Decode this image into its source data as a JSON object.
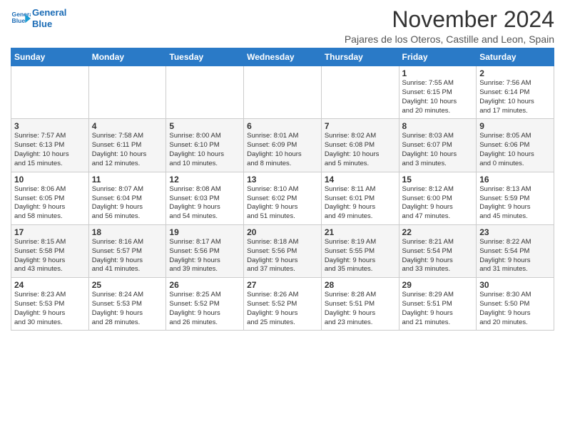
{
  "header": {
    "logo_line1": "General",
    "logo_line2": "Blue",
    "month_title": "November 2024",
    "subtitle": "Pajares de los Oteros, Castille and Leon, Spain"
  },
  "weekdays": [
    "Sunday",
    "Monday",
    "Tuesday",
    "Wednesday",
    "Thursday",
    "Friday",
    "Saturday"
  ],
  "weeks": [
    {
      "days": [
        {
          "num": "",
          "info": ""
        },
        {
          "num": "",
          "info": ""
        },
        {
          "num": "",
          "info": ""
        },
        {
          "num": "",
          "info": ""
        },
        {
          "num": "",
          "info": ""
        },
        {
          "num": "1",
          "info": "Sunrise: 7:55 AM\nSunset: 6:15 PM\nDaylight: 10 hours\nand 20 minutes."
        },
        {
          "num": "2",
          "info": "Sunrise: 7:56 AM\nSunset: 6:14 PM\nDaylight: 10 hours\nand 17 minutes."
        }
      ]
    },
    {
      "days": [
        {
          "num": "3",
          "info": "Sunrise: 7:57 AM\nSunset: 6:13 PM\nDaylight: 10 hours\nand 15 minutes."
        },
        {
          "num": "4",
          "info": "Sunrise: 7:58 AM\nSunset: 6:11 PM\nDaylight: 10 hours\nand 12 minutes."
        },
        {
          "num": "5",
          "info": "Sunrise: 8:00 AM\nSunset: 6:10 PM\nDaylight: 10 hours\nand 10 minutes."
        },
        {
          "num": "6",
          "info": "Sunrise: 8:01 AM\nSunset: 6:09 PM\nDaylight: 10 hours\nand 8 minutes."
        },
        {
          "num": "7",
          "info": "Sunrise: 8:02 AM\nSunset: 6:08 PM\nDaylight: 10 hours\nand 5 minutes."
        },
        {
          "num": "8",
          "info": "Sunrise: 8:03 AM\nSunset: 6:07 PM\nDaylight: 10 hours\nand 3 minutes."
        },
        {
          "num": "9",
          "info": "Sunrise: 8:05 AM\nSunset: 6:06 PM\nDaylight: 10 hours\nand 0 minutes."
        }
      ]
    },
    {
      "days": [
        {
          "num": "10",
          "info": "Sunrise: 8:06 AM\nSunset: 6:05 PM\nDaylight: 9 hours\nand 58 minutes."
        },
        {
          "num": "11",
          "info": "Sunrise: 8:07 AM\nSunset: 6:04 PM\nDaylight: 9 hours\nand 56 minutes."
        },
        {
          "num": "12",
          "info": "Sunrise: 8:08 AM\nSunset: 6:03 PM\nDaylight: 9 hours\nand 54 minutes."
        },
        {
          "num": "13",
          "info": "Sunrise: 8:10 AM\nSunset: 6:02 PM\nDaylight: 9 hours\nand 51 minutes."
        },
        {
          "num": "14",
          "info": "Sunrise: 8:11 AM\nSunset: 6:01 PM\nDaylight: 9 hours\nand 49 minutes."
        },
        {
          "num": "15",
          "info": "Sunrise: 8:12 AM\nSunset: 6:00 PM\nDaylight: 9 hours\nand 47 minutes."
        },
        {
          "num": "16",
          "info": "Sunrise: 8:13 AM\nSunset: 5:59 PM\nDaylight: 9 hours\nand 45 minutes."
        }
      ]
    },
    {
      "days": [
        {
          "num": "17",
          "info": "Sunrise: 8:15 AM\nSunset: 5:58 PM\nDaylight: 9 hours\nand 43 minutes."
        },
        {
          "num": "18",
          "info": "Sunrise: 8:16 AM\nSunset: 5:57 PM\nDaylight: 9 hours\nand 41 minutes."
        },
        {
          "num": "19",
          "info": "Sunrise: 8:17 AM\nSunset: 5:56 PM\nDaylight: 9 hours\nand 39 minutes."
        },
        {
          "num": "20",
          "info": "Sunrise: 8:18 AM\nSunset: 5:56 PM\nDaylight: 9 hours\nand 37 minutes."
        },
        {
          "num": "21",
          "info": "Sunrise: 8:19 AM\nSunset: 5:55 PM\nDaylight: 9 hours\nand 35 minutes."
        },
        {
          "num": "22",
          "info": "Sunrise: 8:21 AM\nSunset: 5:54 PM\nDaylight: 9 hours\nand 33 minutes."
        },
        {
          "num": "23",
          "info": "Sunrise: 8:22 AM\nSunset: 5:54 PM\nDaylight: 9 hours\nand 31 minutes."
        }
      ]
    },
    {
      "days": [
        {
          "num": "24",
          "info": "Sunrise: 8:23 AM\nSunset: 5:53 PM\nDaylight: 9 hours\nand 30 minutes."
        },
        {
          "num": "25",
          "info": "Sunrise: 8:24 AM\nSunset: 5:53 PM\nDaylight: 9 hours\nand 28 minutes."
        },
        {
          "num": "26",
          "info": "Sunrise: 8:25 AM\nSunset: 5:52 PM\nDaylight: 9 hours\nand 26 minutes."
        },
        {
          "num": "27",
          "info": "Sunrise: 8:26 AM\nSunset: 5:52 PM\nDaylight: 9 hours\nand 25 minutes."
        },
        {
          "num": "28",
          "info": "Sunrise: 8:28 AM\nSunset: 5:51 PM\nDaylight: 9 hours\nand 23 minutes."
        },
        {
          "num": "29",
          "info": "Sunrise: 8:29 AM\nSunset: 5:51 PM\nDaylight: 9 hours\nand 21 minutes."
        },
        {
          "num": "30",
          "info": "Sunrise: 8:30 AM\nSunset: 5:50 PM\nDaylight: 9 hours\nand 20 minutes."
        }
      ]
    }
  ]
}
